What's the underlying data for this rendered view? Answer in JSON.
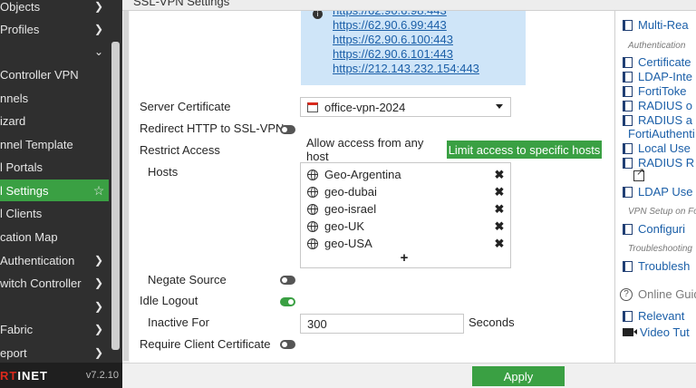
{
  "sidebar": {
    "items": [
      {
        "label": "Objects",
        "chevron": "chevron-right"
      },
      {
        "label": "Profiles",
        "chevron": "chevron-right"
      },
      {
        "label": "",
        "chevron": "chevron-down"
      },
      {
        "label": "Controller VPN",
        "chevron": ""
      },
      {
        "label": "nnels",
        "chevron": ""
      },
      {
        "label": "izard",
        "chevron": ""
      },
      {
        "label": "nnel Template",
        "chevron": ""
      },
      {
        "label": "l Portals",
        "chevron": ""
      },
      {
        "label": "l Settings",
        "chevron": "star",
        "active": true
      },
      {
        "label": "l Clients",
        "chevron": ""
      },
      {
        "label": "cation Map",
        "chevron": ""
      },
      {
        "label": "Authentication",
        "chevron": "chevron-right"
      },
      {
        "label": "witch Controller",
        "chevron": "chevron-right"
      },
      {
        "label": "",
        "chevron": "chevron-right"
      },
      {
        "label": "Fabric",
        "chevron": "chevron-right"
      },
      {
        "label": "eport",
        "chevron": "chevron-right"
      }
    ],
    "brand_red": "RT",
    "brand_white": "INET",
    "version": "v7.2.10"
  },
  "titlebar": {
    "title": "SSL-VPN Settings"
  },
  "urls": [
    "https://62.90.6.98:443",
    "https://62.90.6.99:443",
    "https://62.90.6.100:443",
    "https://62.90.6.101:443",
    "https://212.143.232.154:443"
  ],
  "form": {
    "server_certificate_label": "Server Certificate",
    "server_certificate_value": "office-vpn-2024",
    "redirect_label": "Redirect HTTP to SSL-VPN",
    "redirect_on": false,
    "restrict_label": "Restrict Access",
    "restrict_any": "Allow access from any host",
    "restrict_specific": "Limit access to specific hosts",
    "hosts_label": "Hosts",
    "hosts": [
      "Geo-Argentina",
      "geo-dubai",
      "geo-israel",
      "geo-UK",
      "geo-USA"
    ],
    "add_symbol": "+",
    "remove_symbol": "✖",
    "negate_label": "Negate Source",
    "negate_on": false,
    "idle_label": "Idle Logout",
    "idle_on": true,
    "inactive_label": "Inactive For",
    "inactive_value": "300",
    "inactive_unit": "Seconds",
    "client_cert_label": "Require Client Certificate",
    "client_cert_on": false
  },
  "right_panel": {
    "multi_realm": "Multi-Rea",
    "auth_heading": "Authentication",
    "auth_links": [
      "Certificate",
      "LDAP-Inte",
      "FortiToke",
      "RADIUS o",
      "RADIUS a"
    ],
    "forti_auth": "FortiAuthenti",
    "local_users": "Local Use",
    "radius_r": "RADIUS R",
    "ldap_use": "LDAP Use",
    "vpn_setup_heading": "VPN Setup on Fo",
    "configuring": "Configuri",
    "troubleshooting_heading": "Troubleshooting",
    "troubleshoot": "Troublesh",
    "online_guides": "Online Guid",
    "relevant": "Relevant",
    "video": "Video Tut"
  },
  "footer": {
    "apply_label": "Apply"
  },
  "colors": {
    "accent": "#3aa043",
    "sidebar": "#2f2f2f",
    "link": "#1b5fa8",
    "brand_red": "#da291c"
  }
}
